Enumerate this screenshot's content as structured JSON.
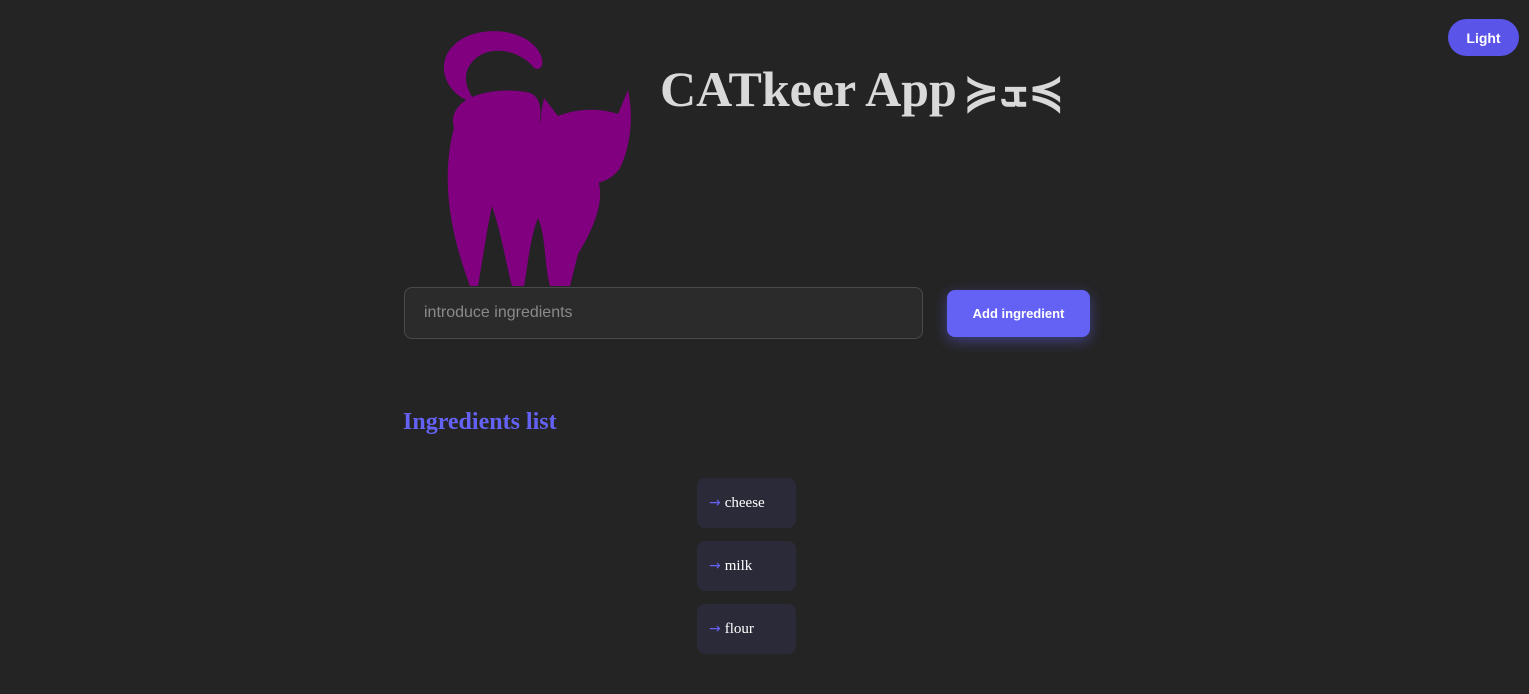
{
  "theme_toggle": {
    "label": "Light"
  },
  "header": {
    "title": "CATkeer App",
    "title_face": "≽ܫ≼",
    "logo_icon": "cat-silhouette-icon",
    "logo_color": "#800080"
  },
  "form": {
    "input_placeholder": "introduce ingredients",
    "input_value": "",
    "add_button_label": "Add ingredient"
  },
  "list": {
    "heading": "Ingredients list",
    "arrow_glyph": "→",
    "items": [
      {
        "label": "cheese"
      },
      {
        "label": "milk"
      },
      {
        "label": "flour"
      }
    ]
  },
  "colors": {
    "background": "#242424",
    "accent": "#6462f5",
    "title_text": "#d9d9d9"
  }
}
